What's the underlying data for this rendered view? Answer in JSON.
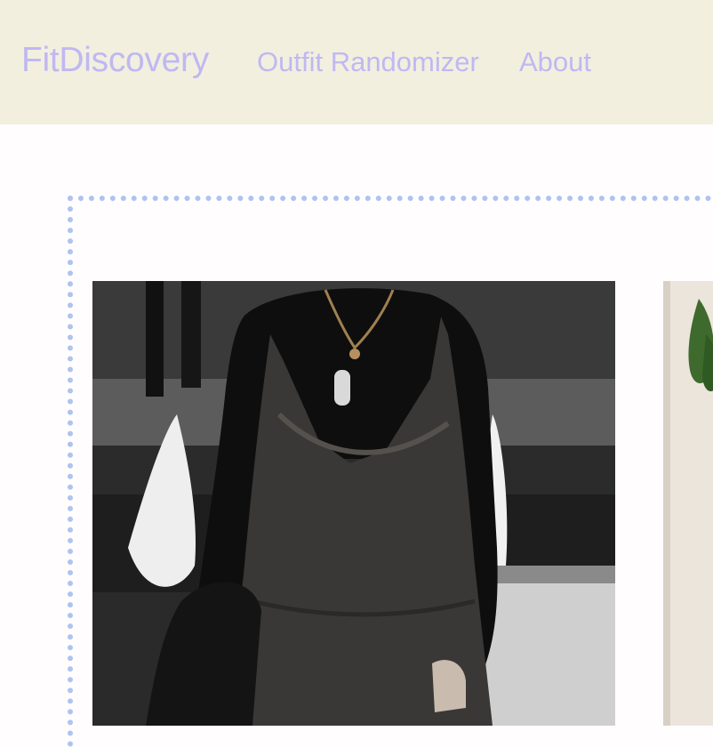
{
  "navbar": {
    "brand": "FitDiscovery",
    "links": [
      {
        "label": "Outfit Randomizer"
      },
      {
        "label": "About"
      }
    ]
  },
  "gallery": {
    "items": [
      {
        "kind": "photo",
        "subject": "person in black long-sleeve top under dark patterned slip dress with pendant necklace, fountain background"
      },
      {
        "kind": "photo",
        "subject": "partially visible photo with plant leaves on light wall"
      }
    ]
  },
  "colors": {
    "navbar_bg": "#f2efdf",
    "brand_text": "#c0b8f2",
    "frame_border": "#aec3f2",
    "page_bg": "#fffdfd"
  }
}
